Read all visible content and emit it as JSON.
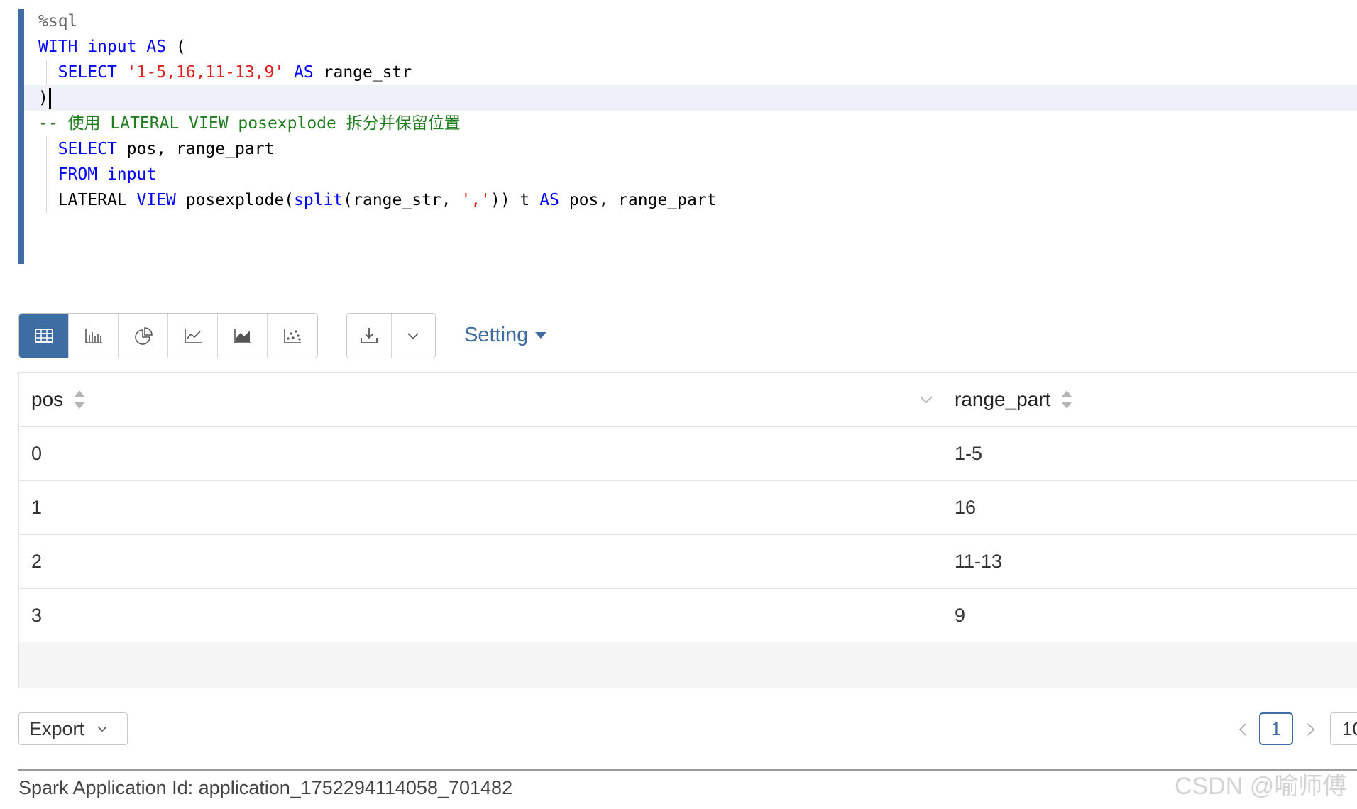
{
  "editor": {
    "lines": {
      "l1": {
        "directive": "%sql"
      },
      "l2": {
        "kw1": "WITH",
        "kw2": "input",
        "kw3": "AS",
        "rest": " ("
      },
      "l3": {
        "kw1": "SELECT",
        "str": "'1-5,16,11-13,9'",
        "kw2": "AS",
        "rest": " range_str"
      },
      "l4": {
        "text": ")"
      },
      "l5": {
        "comment": "-- 使用 LATERAL VIEW posexplode 拆分并保留位置"
      },
      "l6": {
        "kw1": "SELECT",
        "rest": " pos, range_part"
      },
      "l7": {
        "kw1": "FROM",
        "kw2": "input"
      },
      "l8": {
        "p1": "LATERAL ",
        "kw1": "VIEW",
        "p2": " posexplode(",
        "fn": "split",
        "p3": "(range_str, ",
        "str": "','",
        "p4": ")) t ",
        "kw2": "AS",
        "p5": " pos, range_part"
      }
    }
  },
  "toolbar": {
    "viz_icons": [
      "table-icon",
      "bar-chart-icon",
      "pie-chart-icon",
      "line-chart-icon",
      "area-chart-icon",
      "scatter-chart-icon"
    ],
    "active_viz": "table-icon",
    "download_icon": "download-icon",
    "setting_label": "Setting"
  },
  "table": {
    "columns": [
      "pos",
      "range_part"
    ],
    "rows": [
      [
        "0",
        "1-5"
      ],
      [
        "1",
        "16"
      ],
      [
        "2",
        "11-13"
      ],
      [
        "3",
        "9"
      ]
    ]
  },
  "footer": {
    "export_label": "Export",
    "current_page": "1",
    "page_size": "10",
    "app_id": "Spark Application Id: application_1752294114058_701482",
    "watermark": "CSDN @喻师傅"
  },
  "colors": {
    "accent": "#3e6da3",
    "keyword": "#0000ff",
    "string": "#e0201d",
    "comment": "#1f7d1f"
  }
}
